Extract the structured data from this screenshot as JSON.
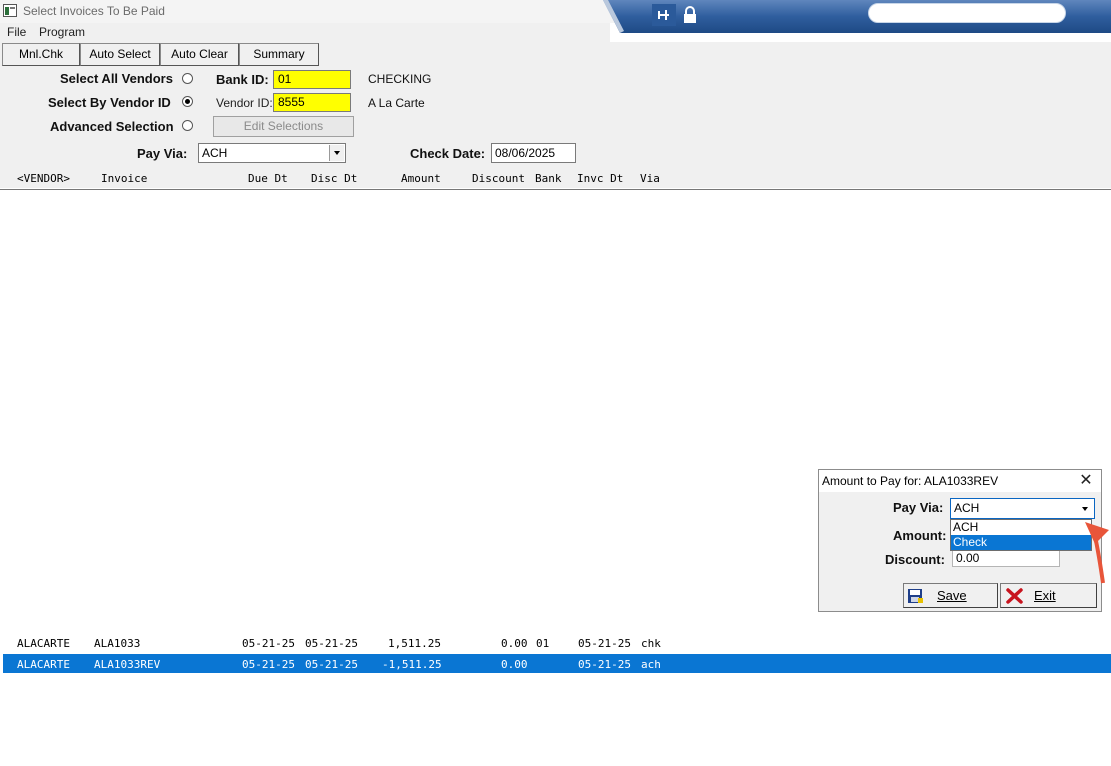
{
  "window": {
    "title": "Select Invoices To Be Paid"
  },
  "menu": {
    "file": "File",
    "program": "Program"
  },
  "toolbar": {
    "mnl_chk": "Mnl.Chk",
    "auto_select": "Auto Select",
    "auto_clear": "Auto Clear",
    "summary": "Summary"
  },
  "form": {
    "select_all_vendors": "Select All Vendors",
    "select_by_vendor": "Select By Vendor ID",
    "advanced_selection": "Advanced Selection",
    "bank_id_label": "Bank ID:",
    "bank_id_value": "01",
    "bank_name": "CHECKING",
    "vendor_id_label": "Vendor ID:",
    "vendor_id_value": "8555",
    "vendor_name": "A La Carte",
    "edit_selections": "Edit Selections",
    "pay_via_label": "Pay Via:",
    "pay_via_value": "ACH",
    "check_date_label": "Check Date:",
    "check_date_value": "08/06/2025",
    "selected_option": "Select By Vendor ID"
  },
  "columns": [
    "<VENDOR>",
    "Invoice",
    "Due Dt",
    "Disc Dt",
    "Amount",
    "Discount",
    "Bank",
    "Invc Dt",
    "Via"
  ],
  "rows": [
    {
      "vendor": "ALACARTE",
      "invoice": "ALA1033",
      "due_dt": "05-21-25",
      "disc_dt": "05-21-25",
      "amount": "1,511.25",
      "discount": "0.00",
      "bank": "01",
      "invc_dt": "05-21-25",
      "via": "chk",
      "selected": false
    },
    {
      "vendor": "ALACARTE",
      "invoice": "ALA1033REV",
      "due_dt": "05-21-25",
      "disc_dt": "05-21-25",
      "amount": "-1,511.25",
      "discount": "0.00",
      "bank": "",
      "invc_dt": "05-21-25",
      "via": "ach",
      "selected": true
    }
  ],
  "dialog": {
    "title": "Amount to Pay for: ALA1033REV",
    "pay_via_label": "Pay Via:",
    "pay_via_value": "ACH",
    "amount_label": "Amount:",
    "discount_label": "Discount:",
    "discount_value": "0.00",
    "dropdown_options": [
      "ACH",
      "Check"
    ],
    "highlighted_option": "Check",
    "save_label": "Save",
    "exit_label": "Exit"
  },
  "colors": {
    "selected_row": "#0a76d3",
    "field_highlight": "#ffff00",
    "banner": "#2f5e9e",
    "annotation_arrow": "#e8553a"
  },
  "icons": [
    "app-icon",
    "pin-icon",
    "lock-icon",
    "close-icon",
    "chevron-down-icon",
    "save-disk-icon",
    "exit-x-icon",
    "annotation-arrow"
  ]
}
